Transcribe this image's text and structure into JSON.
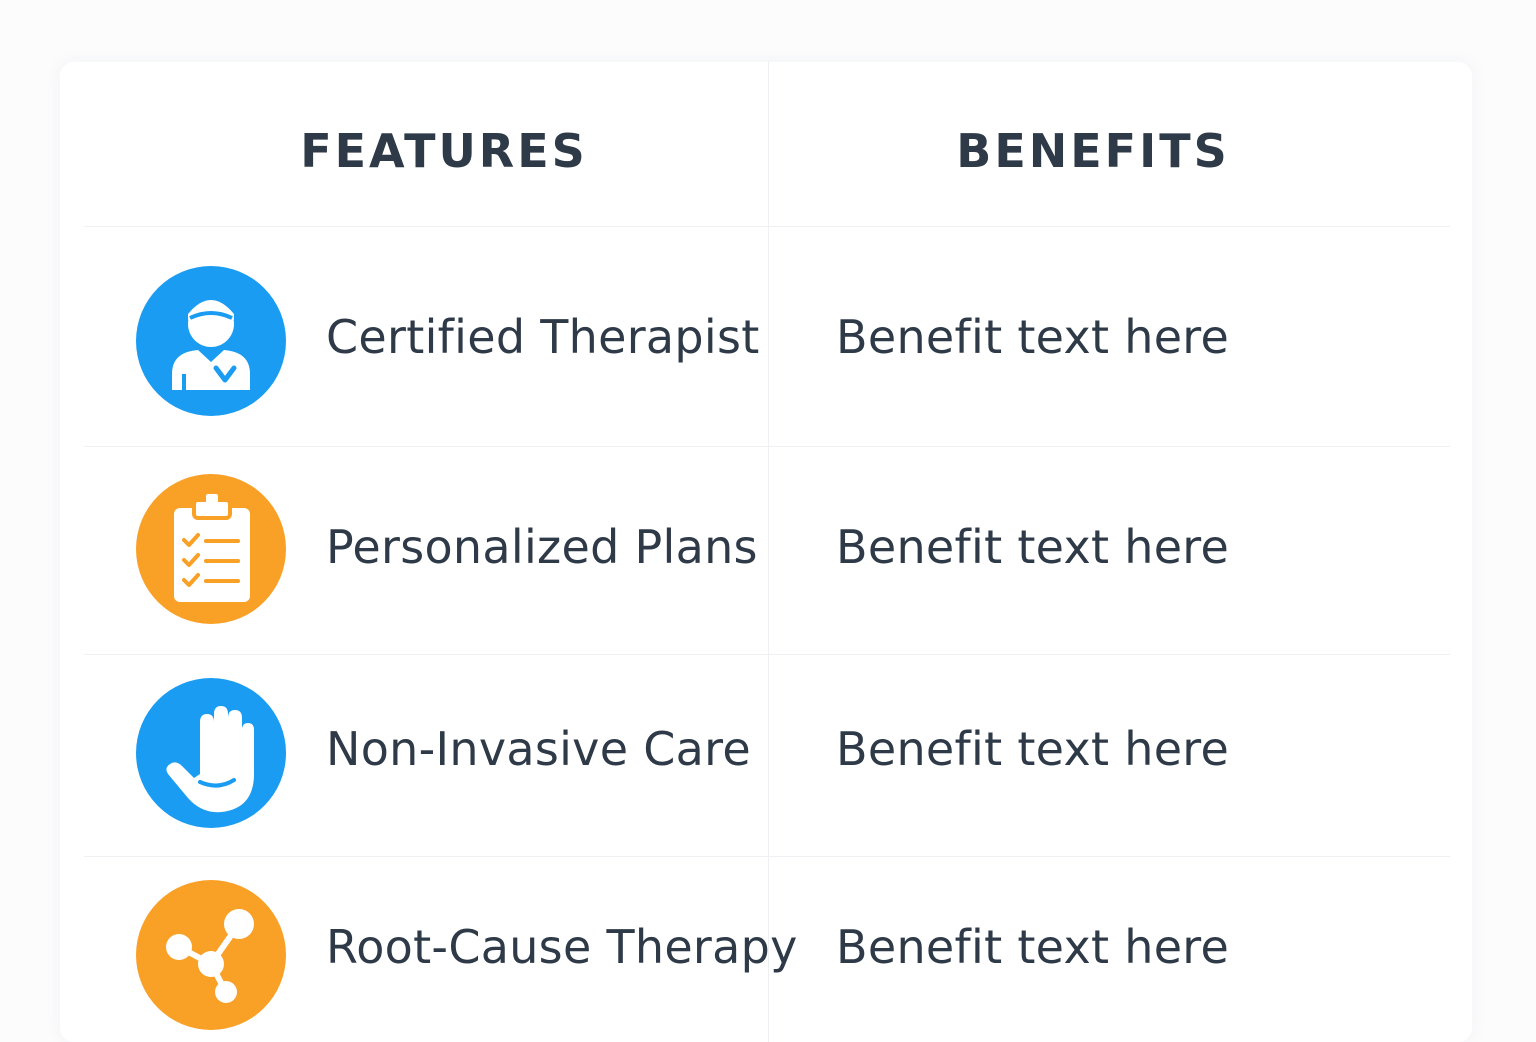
{
  "table": {
    "headers": {
      "features": "FEATURES",
      "benefits": "BENEFITS"
    },
    "rows": [
      {
        "feature": "Certified Therapist",
        "benefit": "Benefit text here",
        "icon": "therapist-icon",
        "color": "#1a9cf2"
      },
      {
        "feature": "Personalized Plans",
        "benefit": "Benefit text here",
        "icon": "clipboard-checklist-icon",
        "color": "#f9a027"
      },
      {
        "feature": "Non-Invasive Care",
        "benefit": "Benefit text here",
        "icon": "hand-icon",
        "color": "#1a9cf2"
      },
      {
        "feature": "Root-Cause Therapy",
        "benefit": "Benefit text here",
        "icon": "molecule-icon",
        "color": "#f9a027"
      }
    ]
  },
  "colors": {
    "blue": "#1a9cf2",
    "orange": "#f9a027",
    "text": "#2f3a48",
    "divider": "#eef0f3"
  }
}
